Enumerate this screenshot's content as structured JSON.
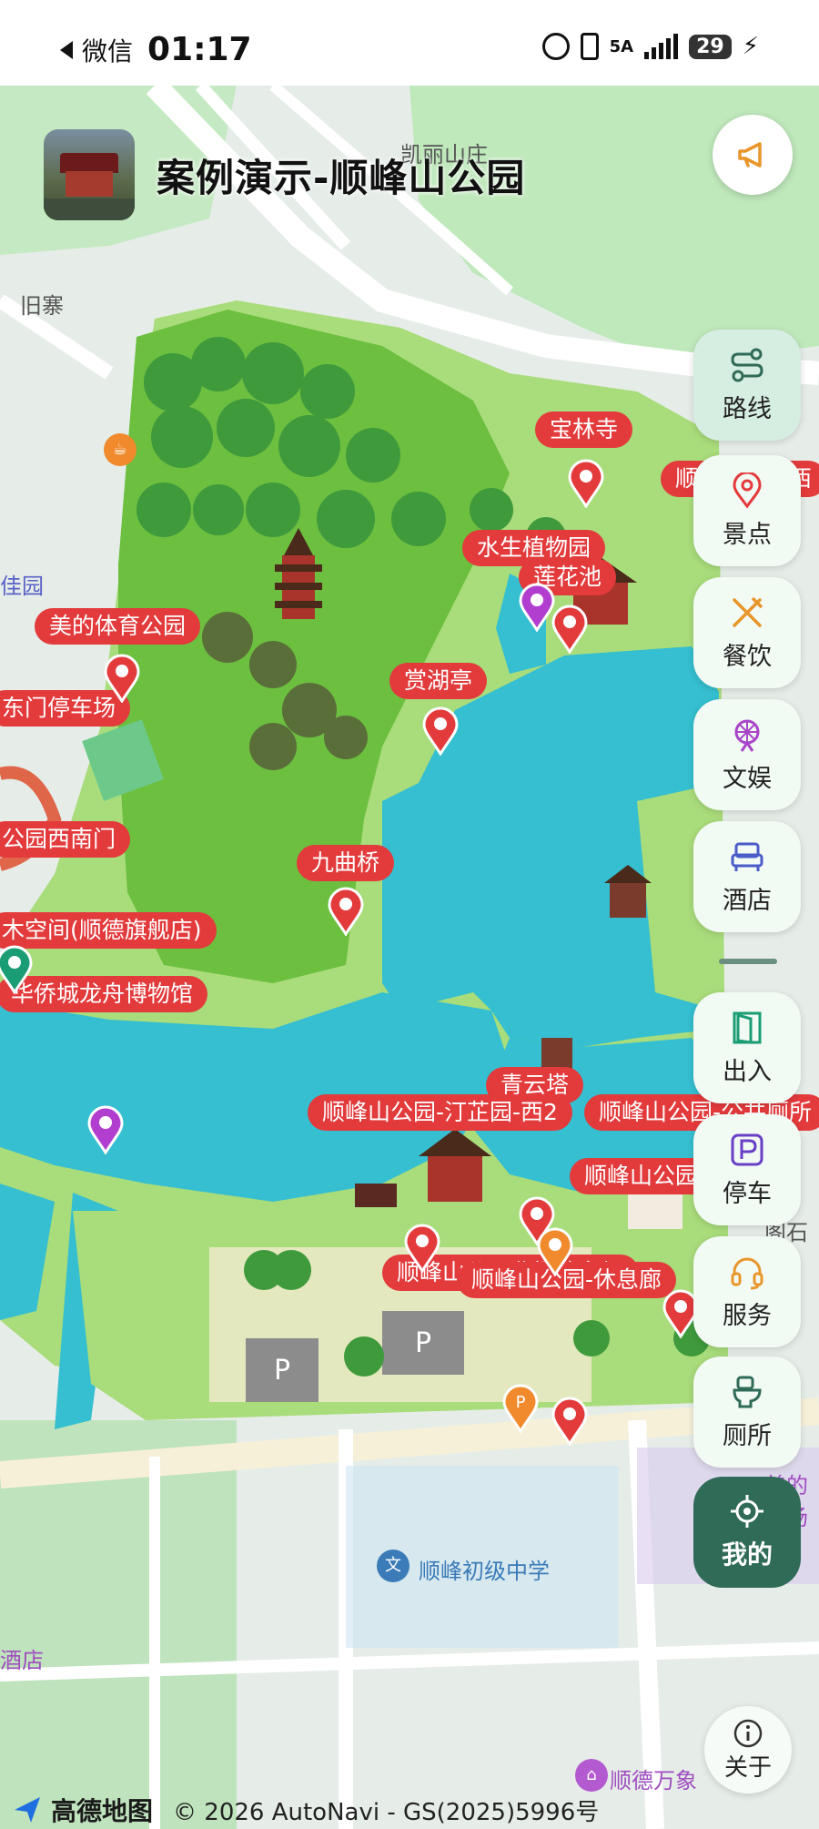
{
  "status_bar": {
    "app_name": "微信",
    "time": "01:17",
    "network": "5A",
    "battery": "29"
  },
  "header": {
    "title": "案例演示-顺峰山公园",
    "announcement_icon": "megaphone-icon"
  },
  "map": {
    "place_labels": [
      "凯丽山庄",
      "旧寨",
      "佳园",
      "顺峰初级中学",
      "顺德万象",
      "酒店",
      "美的广场",
      "阁石"
    ],
    "poi_labels": [
      "宝林寺",
      "顺峰山公园西",
      "水生植物园",
      "莲花池",
      "美的体育公园",
      "东门停车场",
      "赏湖亭",
      "公园西南门",
      "九曲桥",
      "木空间(顺德旗舰店)",
      "华侨城龙舟博物馆",
      "青云塔",
      "顺峰山公园-汀芷园-西2",
      "顺峰山公园-公共厕所",
      "顺峰山公园",
      "顺峰山公园北门停车场",
      "顺峰山公园-休息廊"
    ]
  },
  "side_menu": {
    "items": [
      {
        "label": "路线",
        "icon": "route-icon"
      },
      {
        "label": "景点",
        "icon": "location-pin-icon"
      },
      {
        "label": "餐饮",
        "icon": "fork-knife-icon"
      },
      {
        "label": "文娱",
        "icon": "ferris-wheel-icon"
      },
      {
        "label": "酒店",
        "icon": "bed-icon"
      },
      {
        "label": "出入",
        "icon": "door-icon"
      },
      {
        "label": "停车",
        "icon": "parking-icon"
      },
      {
        "label": "服务",
        "icon": "headset-icon"
      },
      {
        "label": "厕所",
        "icon": "toilet-icon"
      }
    ],
    "locate_label": "我的",
    "about_label": "关于"
  },
  "footer": {
    "brand": "高德地图",
    "copyright": "© 2026 AutoNavi - GS(2025)5996号"
  },
  "colors": {
    "accent_green": "#2f6b57",
    "pin_red": "#e33a3c",
    "water": "#35bfd0",
    "park_green": "#6fc24a"
  }
}
